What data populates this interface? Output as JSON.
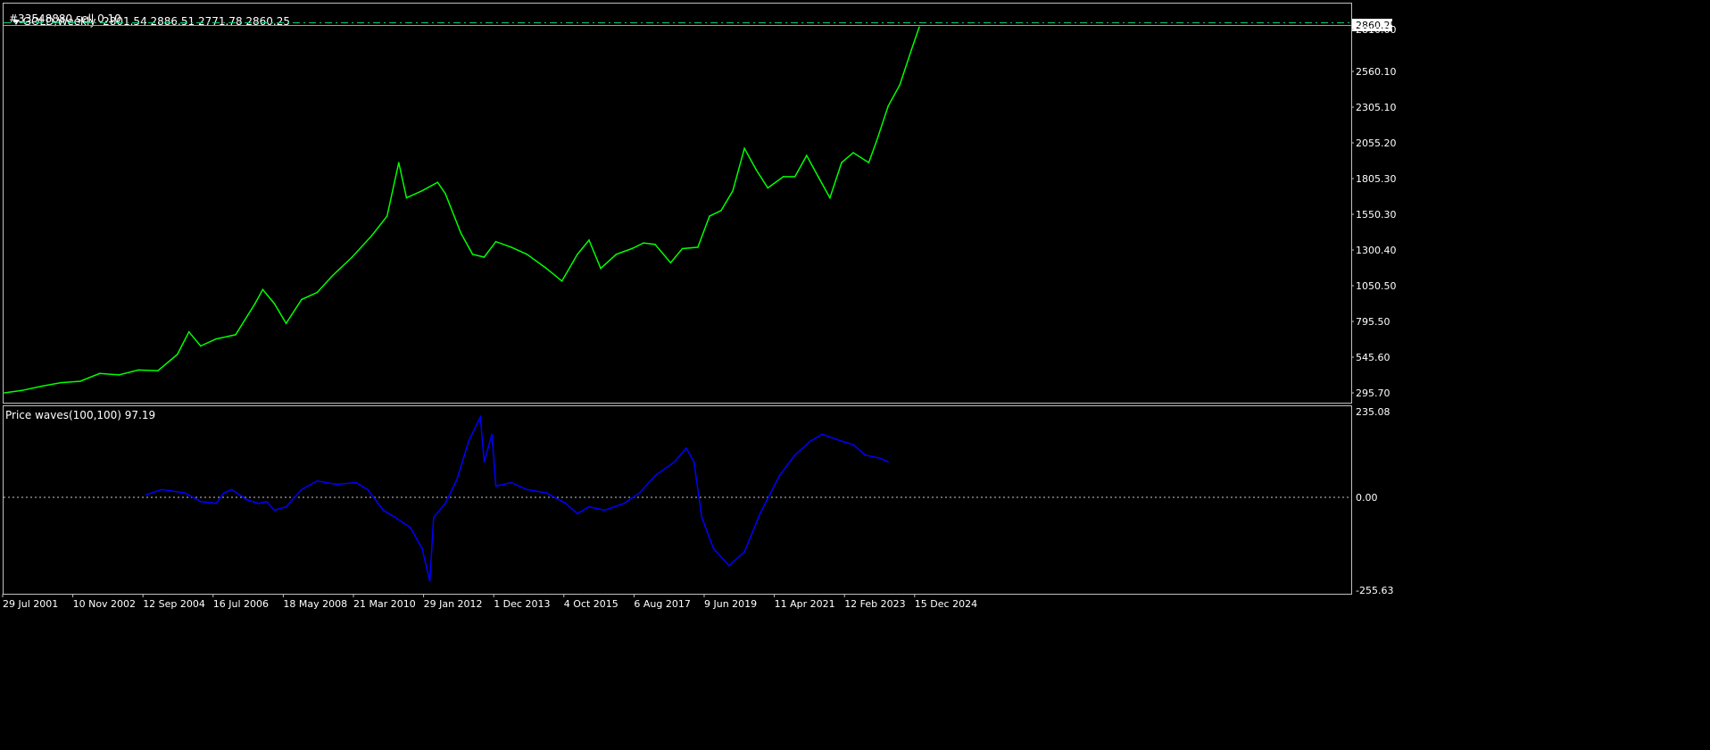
{
  "header": {
    "title": "GOLD,Weekly",
    "ohlc": "2801.54 2886.51 2771.78 2860.25",
    "order_label": "#33548880 sell 0.10"
  },
  "indicator": {
    "label": "Price waves(100,100) 97.19"
  },
  "colors": {
    "background": "#000000",
    "price_line": "#00ff00",
    "indicator_line": "#0000ff",
    "frame": "#c0c0c0",
    "order_line": "#00cc66",
    "zero_line": "#c8c8c8"
  },
  "chart_data": [
    {
      "type": "line",
      "series": [
        {
          "values": [
            [
              2001.55,
              268
            ],
            [
              2002.0,
              285
            ],
            [
              2002.5,
              315
            ],
            [
              2003.0,
              340
            ],
            [
              2003.5,
              350
            ],
            [
              2004.0,
              405
            ],
            [
              2004.5,
              395
            ],
            [
              2005.0,
              430
            ],
            [
              2005.5,
              425
            ],
            [
              2006.0,
              540
            ],
            [
              2006.3,
              700
            ],
            [
              2006.6,
              600
            ],
            [
              2007.0,
              650
            ],
            [
              2007.5,
              680
            ],
            [
              2008.0,
              900
            ],
            [
              2008.2,
              1000
            ],
            [
              2008.5,
              900
            ],
            [
              2008.8,
              760
            ],
            [
              2009.2,
              930
            ],
            [
              2009.6,
              980
            ],
            [
              2010.0,
              1100
            ],
            [
              2010.5,
              1230
            ],
            [
              2011.0,
              1380
            ],
            [
              2011.4,
              1520
            ],
            [
              2011.7,
              1900
            ],
            [
              2011.9,
              1650
            ],
            [
              2012.3,
              1700
            ],
            [
              2012.7,
              1760
            ],
            [
              2012.9,
              1680
            ],
            [
              2013.3,
              1400
            ],
            [
              2013.6,
              1250
            ],
            [
              2013.9,
              1230
            ],
            [
              2014.2,
              1340
            ],
            [
              2014.6,
              1300
            ],
            [
              2015.0,
              1250
            ],
            [
              2015.5,
              1150
            ],
            [
              2015.9,
              1060
            ],
            [
              2016.3,
              1250
            ],
            [
              2016.6,
              1350
            ],
            [
              2016.9,
              1150
            ],
            [
              2017.3,
              1250
            ],
            [
              2017.7,
              1290
            ],
            [
              2018.0,
              1330
            ],
            [
              2018.3,
              1320
            ],
            [
              2018.7,
              1190
            ],
            [
              2019.0,
              1290
            ],
            [
              2019.4,
              1300
            ],
            [
              2019.7,
              1520
            ],
            [
              2020.0,
              1560
            ],
            [
              2020.3,
              1700
            ],
            [
              2020.6,
              2000
            ],
            [
              2020.9,
              1850
            ],
            [
              2021.2,
              1720
            ],
            [
              2021.6,
              1800
            ],
            [
              2021.9,
              1800
            ],
            [
              2022.2,
              1950
            ],
            [
              2022.5,
              1800
            ],
            [
              2022.8,
              1650
            ],
            [
              2023.1,
              1900
            ],
            [
              2023.4,
              1970
            ],
            [
              2023.8,
              1900
            ],
            [
              2024.0,
              2050
            ],
            [
              2024.3,
              2300
            ],
            [
              2024.6,
              2450
            ],
            [
              2024.9,
              2700
            ],
            [
              2025.1,
              2860
            ]
          ]
        }
      ],
      "y_ticks": [
        "2860.25",
        "2810.00",
        "2560.10",
        "2305.10",
        "2055.20",
        "1805.30",
        "1550.30",
        "1300.40",
        "1050.50",
        "795.50",
        "545.60",
        "295.70"
      ],
      "x_ticks": [
        "29 Jul 2001",
        "10 Nov 2002",
        "12 Sep 2004",
        "16 Jul 2006",
        "18 May 2008",
        "21 Mar 2010",
        "29 Jan 2012",
        "1 Dec 2013",
        "4 Oct 2015",
        "6 Aug 2017",
        "9 Jun 2019",
        "11 Apr 2021",
        "12 Feb 2023",
        "15 Dec 2024"
      ],
      "ylim": [
        268,
        2900
      ],
      "current_price": 2860.25
    },
    {
      "type": "line",
      "series": [
        {
          "values": [
            [
              2005.2,
              5
            ],
            [
              2005.6,
              20
            ],
            [
              2006.2,
              10
            ],
            [
              2006.6,
              -15
            ],
            [
              2007.0,
              -20
            ],
            [
              2007.2,
              10
            ],
            [
              2007.4,
              20
            ],
            [
              2007.8,
              -10
            ],
            [
              2008.1,
              -20
            ],
            [
              2008.3,
              -15
            ],
            [
              2008.5,
              -40
            ],
            [
              2008.8,
              -30
            ],
            [
              2009.2,
              20
            ],
            [
              2009.6,
              45
            ],
            [
              2010.1,
              35
            ],
            [
              2010.6,
              40
            ],
            [
              2010.9,
              20
            ],
            [
              2011.3,
              -40
            ],
            [
              2011.6,
              -60
            ],
            [
              2012.0,
              -90
            ],
            [
              2012.3,
              -150
            ],
            [
              2012.5,
              -245
            ],
            [
              2012.6,
              -60
            ],
            [
              2012.9,
              -20
            ],
            [
              2013.2,
              50
            ],
            [
              2013.5,
              160
            ],
            [
              2013.8,
              230
            ],
            [
              2013.9,
              100
            ],
            [
              2014.1,
              180
            ],
            [
              2014.2,
              30
            ],
            [
              2014.6,
              40
            ],
            [
              2015.0,
              20
            ],
            [
              2015.5,
              10
            ],
            [
              2016.0,
              -20
            ],
            [
              2016.3,
              -50
            ],
            [
              2016.6,
              -30
            ],
            [
              2017.0,
              -40
            ],
            [
              2017.5,
              -20
            ],
            [
              2017.9,
              10
            ],
            [
              2018.3,
              60
            ],
            [
              2018.8,
              100
            ],
            [
              2019.1,
              140
            ],
            [
              2019.3,
              100
            ],
            [
              2019.5,
              -60
            ],
            [
              2019.8,
              -150
            ],
            [
              2020.2,
              -200
            ],
            [
              2020.6,
              -160
            ],
            [
              2021.0,
              -50
            ],
            [
              2021.5,
              60
            ],
            [
              2021.9,
              120
            ],
            [
              2022.3,
              160
            ],
            [
              2022.6,
              180
            ],
            [
              2023.1,
              160
            ],
            [
              2023.4,
              150
            ],
            [
              2023.7,
              120
            ],
            [
              2024.1,
              110
            ],
            [
              2024.3,
              100
            ]
          ]
        }
      ],
      "y_ticks": [
        "235.08",
        "0.00",
        "-255.63"
      ],
      "ylim": [
        -255.63,
        235.08
      ]
    }
  ]
}
